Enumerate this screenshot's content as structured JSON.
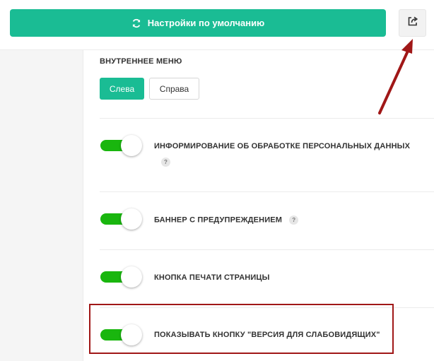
{
  "toolbar": {
    "reset_label": "Настройки по умолчанию",
    "reset_icon": "refresh-icon",
    "share_icon": "share-icon"
  },
  "inner_menu": {
    "title": "ВНУТРЕННЕЕ МЕНЮ",
    "options": [
      "Слева",
      "Справа"
    ],
    "selected": "Слева"
  },
  "settings": [
    {
      "label": "ИНФОРМИРОВАНИЕ ОБ ОБРАБОТКЕ ПЕРСОНАЛЬНЫХ ДАННЫХ",
      "enabled": true,
      "help": "?"
    },
    {
      "label": "БАННЕР С ПРЕДУПРЕЖДЕНИЕМ",
      "enabled": true,
      "help": "?"
    },
    {
      "label": "КНОПКА ПЕЧАТИ СТРАНИЦЫ",
      "enabled": true
    },
    {
      "label": "ПОКАЗЫВАТЬ КНОПКУ \"ВЕРСИЯ ДЛЯ СЛАБОВИДЯЩИХ\"",
      "enabled": true
    }
  ],
  "colors": {
    "accent": "#1abc94",
    "toggle_on": "#19b60e",
    "annotation": "#a01717"
  }
}
